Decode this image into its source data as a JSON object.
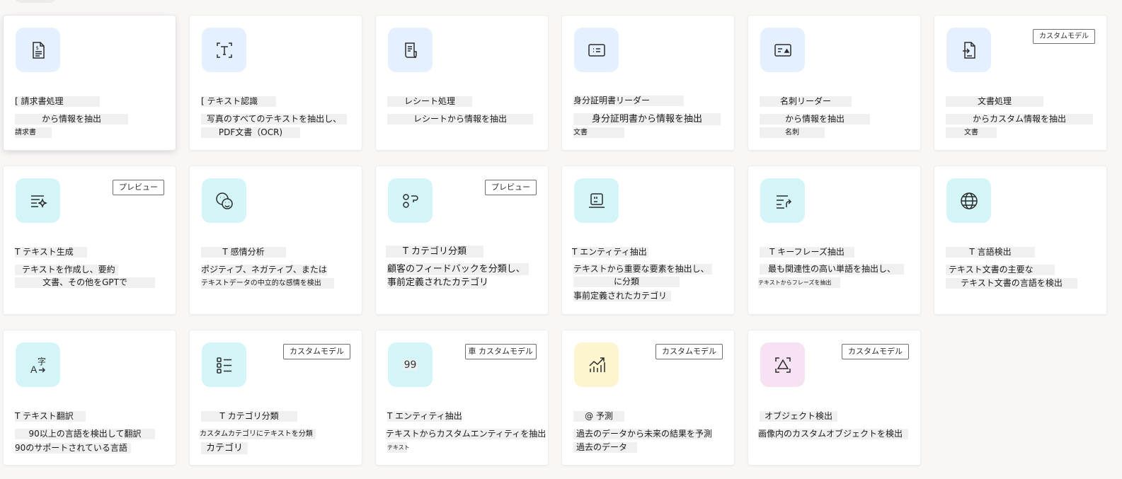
{
  "colors": {
    "tile_blue": "#e5f0fe",
    "tile_cyan": "#d4f5f7",
    "tile_yellow": "#fdf5d0",
    "tile_pink": "#f6e2f3",
    "icon_stroke": "#2b2b2b"
  },
  "cards": [
    {
      "icon": "invoice-icon",
      "title": "[ 請求書処理",
      "line1": "から情報を抽出",
      "line2": "請求書"
    },
    {
      "icon": "text-recognition-icon",
      "title": "[ テキスト認識",
      "line1": "写真のすべてのテキストを抽出し、",
      "line2": "PDF文書（OCR)"
    },
    {
      "icon": "receipt-icon",
      "title": "レシート処理",
      "line1": "レシートから情報を抽出"
    },
    {
      "icon": "id-card-icon",
      "title": "身分証明書リーダー",
      "line1": "身分証明書から情報を抽出",
      "line2": "文書"
    },
    {
      "icon": "business-card-icon",
      "title": "名刺リーダー",
      "line1": "から情報を抽出",
      "line2": "名刺"
    },
    {
      "icon": "document-icon",
      "badge": "カスタムモデル",
      "title": "文書処理",
      "line1": "からカスタム情報を抽出",
      "line2": "文書"
    },
    {
      "icon": "text-generation-icon",
      "badge": "プレビュー",
      "title": "T テキスト生成",
      "line1": "テキストを作成し、要約",
      "line2": "文書、その他をGPTで"
    },
    {
      "icon": "sentiment-icon",
      "title": "T 感情分析",
      "line1": "ポジティブ、ネガティブ、または",
      "line2": "テキストデータの中立的な感情を検出"
    },
    {
      "icon": "classification-icon",
      "badge": "プレビュー",
      "title": "T カテゴリ分類",
      "line1": "顧客のフィードバックを分類し、",
      "line2": "事前定義されたカテゴリ"
    },
    {
      "icon": "entity-extraction-icon",
      "title": "T エンティティ抽出",
      "line1": "テキストから重要な要素を抽出し、",
      "line2": "に分類",
      "line3": "事前定義されたカテゴリ"
    },
    {
      "icon": "key-phrase-icon",
      "title": "T キーフレーズ抽出",
      "line1": "最も関連性の高い単語を抽出し、",
      "line2": "テキストからフレーズを抽出"
    },
    {
      "icon": "globe-icon",
      "title": "T 言語検出",
      "line1": "テキスト文書の主要な",
      "line2": "テキスト文書の言語を検出"
    },
    {
      "icon": "translate-icon",
      "title": "T テキスト翻訳",
      "line1": "90以上の言語を検出して翻訳",
      "line2": "90のサポートされている言語"
    },
    {
      "icon": "list-icon",
      "badge": "カスタムモデル",
      "title": "T カテゴリ分類",
      "line1": "カスタムカテゴリにテキストを分類",
      "line2": "カテゴリ"
    },
    {
      "icon": "quote-icon",
      "icon_text": "99",
      "badge": "車 カスタムモデル",
      "title": "T エンティティ抽出",
      "line1": "テキストからカスタムエンティティを抽出",
      "line2": "テキスト"
    },
    {
      "icon": "chart-icon",
      "badge": "カスタムモデル",
      "title": "@ 予測",
      "line1": "過去のデータから未来の結果を予測",
      "line2": "過去のデータ"
    },
    {
      "icon": "object-detection-icon",
      "badge": "カスタムモデル",
      "title": "オブジェクト検出",
      "line1": "画像内のカスタムオブジェクトを検出"
    }
  ]
}
